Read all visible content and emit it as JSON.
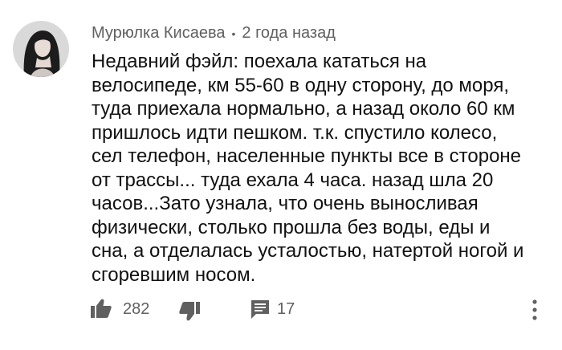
{
  "comment": {
    "author": "Мурюлка Кисаева",
    "separator": "•",
    "timestamp": "2 года назад",
    "text": "Недавний фэйл:  поехала кататься на\nвелосипеде,  км 55-60 в одну сторону, до моря,\nтуда приехала нормально,  а назад около 60 км\nпришлось идти пешком. т.к. спустило колесо,\nсел телефон, населенные пункты все в стороне\nот трассы... туда ехала 4 часа. назад шла 20\nчасов...Зато узнала, что очень выносливая\nфизически, столько прошла без воды, еды и\nсна, а отделалась усталостью, натертой ногой и\nсгоревшим носом."
  },
  "actions": {
    "like_icon": "thumb-up-icon",
    "like_count": "282",
    "dislike_icon": "thumb-down-icon",
    "reply_icon": "comment-icon",
    "reply_count": "17",
    "menu_icon": "more-vertical-icon"
  },
  "colors": {
    "meta_text": "#606060",
    "icon": "#606060",
    "text": "#111111"
  }
}
